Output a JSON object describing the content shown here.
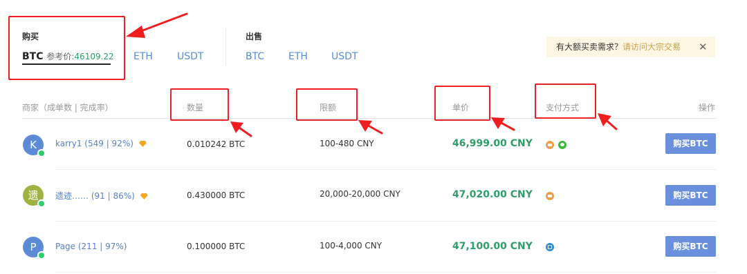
{
  "buy": {
    "label": "购买",
    "active_coin": "BTC",
    "ref_prefix": "参考价:",
    "ref_price": "46109.22",
    "coins": [
      "ETH",
      "USDT"
    ]
  },
  "sell": {
    "label": "出售",
    "coins": [
      "BTC",
      "ETH",
      "USDT"
    ]
  },
  "notice": {
    "text": "有大额买卖需求？",
    "link": "请访问大宗交易",
    "close": "✕"
  },
  "columns": {
    "merchant": "商家（成单数 | 完成率）",
    "amount": "数量",
    "limit": "限额",
    "price": "单价",
    "payment": "支付方式",
    "action": "操作"
  },
  "rows": [
    {
      "avatar_letter": "K",
      "avatar_color": "#5b8bd6",
      "merchant": "karry1 (549 | 92%)",
      "amount": "0.010242 BTC",
      "limit": "100-480 CNY",
      "price": "46,999.00 CNY",
      "payments": [
        "bank-icon",
        "wechat-icon"
      ],
      "button": "购买BTC"
    },
    {
      "avatar_letter": "遗",
      "avatar_color": "#a0b041",
      "merchant": "遗迹…… (91 | 86%)",
      "amount": "0.430000 BTC",
      "limit": "20,000-20,000 CNY",
      "price": "47,020.00 CNY",
      "payments": [
        "bank-icon"
      ],
      "button": "购买BTC"
    },
    {
      "avatar_letter": "P",
      "avatar_color": "#5b8bd6",
      "merchant": "Page (211 | 97%)",
      "amount": "0.100000 BTC",
      "limit": "100-4,000 CNY",
      "price": "47,100.00 CNY",
      "payments": [
        "alipay-icon"
      ],
      "button": "购买BTC"
    }
  ],
  "colors": {
    "annotation_red": "#f01e1e",
    "price_green": "#2e9e6a",
    "button_blue": "#6a8fdc",
    "link_blue": "#5b8bd6"
  }
}
